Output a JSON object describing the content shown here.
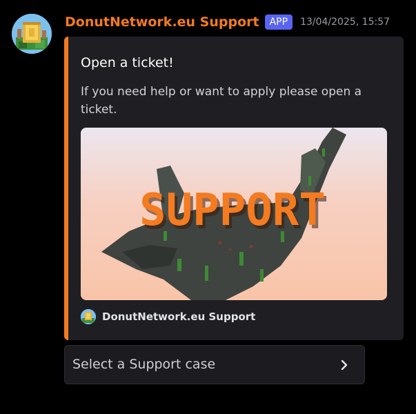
{
  "message": {
    "author": "DonutNetwork.eu Support",
    "badge": "APP",
    "timestamp": "13/04/2025, 15:57"
  },
  "embed": {
    "accent_color": "#f47b20",
    "title": "Open a ticket!",
    "description": "If you need help or want to apply please open a ticket.",
    "image_text": "SUPPORT",
    "footer_text": "DonutNetwork.eu Support"
  },
  "select": {
    "placeholder": "Select a Support case",
    "icon": "chevron-right-icon"
  },
  "colors": {
    "background": "#000000",
    "username": "#f47b20",
    "badge": "#5865f2",
    "embed_bg": "#1f1f23"
  }
}
